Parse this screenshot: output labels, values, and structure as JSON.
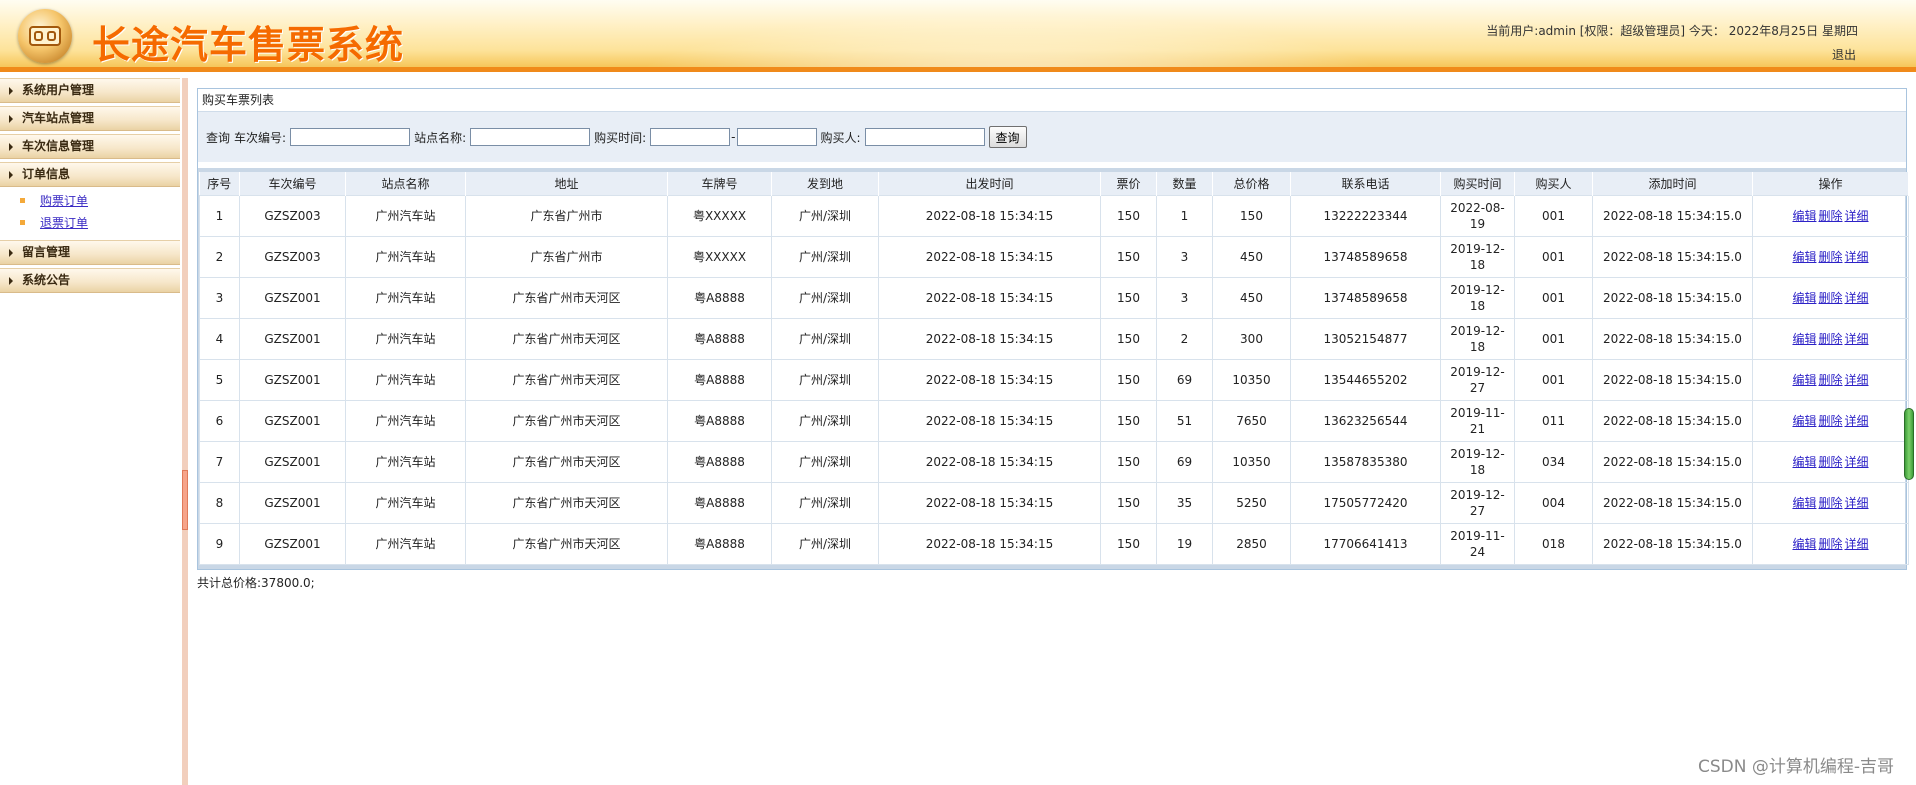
{
  "header": {
    "app_title": "长途汽车售票系统",
    "user_info": "当前用户:admin [权限：超级管理员] 今天：  2022年8月25日 星期四",
    "logout": "退出"
  },
  "sidebar": {
    "items": [
      {
        "label": "系统用户管理"
      },
      {
        "label": "汽车站点管理"
      },
      {
        "label": "车次信息管理"
      },
      {
        "label": "订单信息",
        "children": [
          "购票订单",
          "退票订单"
        ]
      },
      {
        "label": "留言管理"
      },
      {
        "label": "系统公告"
      }
    ]
  },
  "panel": {
    "title": "购买车票列表"
  },
  "search": {
    "prefix": "查询",
    "train_no_label": "车次编号:",
    "station_label": "站点名称:",
    "buy_time_label": "购买时间:",
    "dash": "-",
    "buyer_label": "购买人:",
    "button": "查询"
  },
  "table": {
    "headers": [
      "序号",
      "车次编号",
      "站点名称",
      "地址",
      "车牌号",
      "发到地",
      "出发时间",
      "票价",
      "数量",
      "总价格",
      "联系电话",
      "购买时间",
      "购买人",
      "添加时间",
      "操作"
    ],
    "rows": [
      [
        "1",
        "GZSZ003",
        "广州汽车站",
        "广东省广州市",
        "粤XXXXX",
        "广州/深圳",
        "2022-08-18 15:34:15",
        "150",
        "1",
        "150",
        "13222223344",
        "2022-08-19",
        "001",
        "2022-08-18 15:34:15.0"
      ],
      [
        "2",
        "GZSZ003",
        "广州汽车站",
        "广东省广州市",
        "粤XXXXX",
        "广州/深圳",
        "2022-08-18 15:34:15",
        "150",
        "3",
        "450",
        "13748589658",
        "2019-12-18",
        "001",
        "2022-08-18 15:34:15.0"
      ],
      [
        "3",
        "GZSZ001",
        "广州汽车站",
        "广东省广州市天河区",
        "粤A8888",
        "广州/深圳",
        "2022-08-18 15:34:15",
        "150",
        "3",
        "450",
        "13748589658",
        "2019-12-18",
        "001",
        "2022-08-18 15:34:15.0"
      ],
      [
        "4",
        "GZSZ001",
        "广州汽车站",
        "广东省广州市天河区",
        "粤A8888",
        "广州/深圳",
        "2022-08-18 15:34:15",
        "150",
        "2",
        "300",
        "13052154877",
        "2019-12-18",
        "001",
        "2022-08-18 15:34:15.0"
      ],
      [
        "5",
        "GZSZ001",
        "广州汽车站",
        "广东省广州市天河区",
        "粤A8888",
        "广州/深圳",
        "2022-08-18 15:34:15",
        "150",
        "69",
        "10350",
        "13544655202",
        "2019-12-27",
        "001",
        "2022-08-18 15:34:15.0"
      ],
      [
        "6",
        "GZSZ001",
        "广州汽车站",
        "广东省广州市天河区",
        "粤A8888",
        "广州/深圳",
        "2022-08-18 15:34:15",
        "150",
        "51",
        "7650",
        "13623256544",
        "2019-11-21",
        "011",
        "2022-08-18 15:34:15.0"
      ],
      [
        "7",
        "GZSZ001",
        "广州汽车站",
        "广东省广州市天河区",
        "粤A8888",
        "广州/深圳",
        "2022-08-18 15:34:15",
        "150",
        "69",
        "10350",
        "13587835380",
        "2019-12-18",
        "034",
        "2022-08-18 15:34:15.0"
      ],
      [
        "8",
        "GZSZ001",
        "广州汽车站",
        "广东省广州市天河区",
        "粤A8888",
        "广州/深圳",
        "2022-08-18 15:34:15",
        "150",
        "35",
        "5250",
        "17505772420",
        "2019-12-27",
        "004",
        "2022-08-18 15:34:15.0"
      ],
      [
        "9",
        "GZSZ001",
        "广州汽车站",
        "广东省广州市天河区",
        "粤A8888",
        "广州/深圳",
        "2022-08-18 15:34:15",
        "150",
        "19",
        "2850",
        "17706641413",
        "2019-11-24",
        "018",
        "2022-08-18 15:34:15.0"
      ]
    ],
    "actions": [
      "编辑",
      "删除",
      "详细"
    ]
  },
  "total": "共计总价格:37800.0;",
  "watermark": "CSDN @计算机编程-吉哥"
}
